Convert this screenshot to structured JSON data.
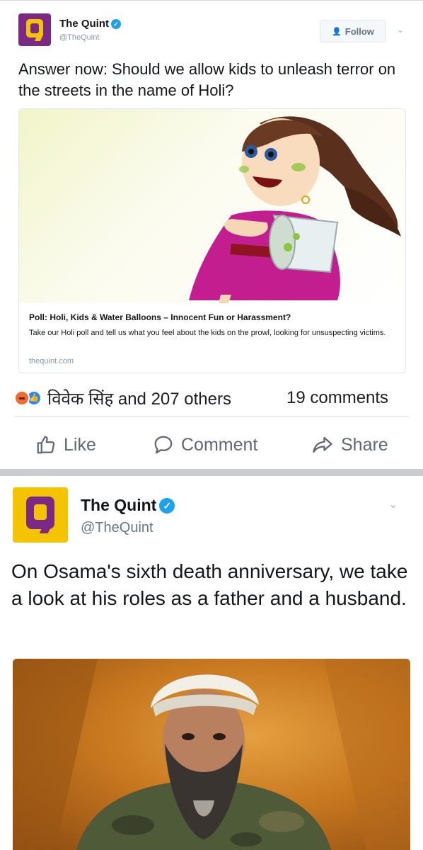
{
  "tweet1": {
    "account_name": "The Quint",
    "handle": "@TheQuint",
    "follow_label": "Follow",
    "text": "Answer now: Should we allow kids to unleash terror on the streets in the name of Holi?",
    "card": {
      "title": "Poll: Holi, Kids & Water Balloons – Innocent Fun or Harassment?",
      "description": "Take our Holi poll and tell us what you feel about the kids on the prowl, looking for unsuspecting victims.",
      "domain": "thequint.com"
    }
  },
  "reactions": {
    "names": "विवेक सिंह and 207 others",
    "comments": "19 comments",
    "icons": [
      "angry-reaction-icon",
      "like-reaction-icon"
    ]
  },
  "actions": {
    "like": "Like",
    "comment": "Comment",
    "share": "Share"
  },
  "tweet2": {
    "account_name": "The Quint",
    "handle": "@TheQuint",
    "text": "On Osama's sixth death anniversary, we take a look at his roles as a father and a husband."
  },
  "colors": {
    "quint_purple": "#7a2a86",
    "quint_yellow": "#f5c400",
    "twitter_blue": "#1da1f2",
    "fb_grey": "#606770"
  }
}
